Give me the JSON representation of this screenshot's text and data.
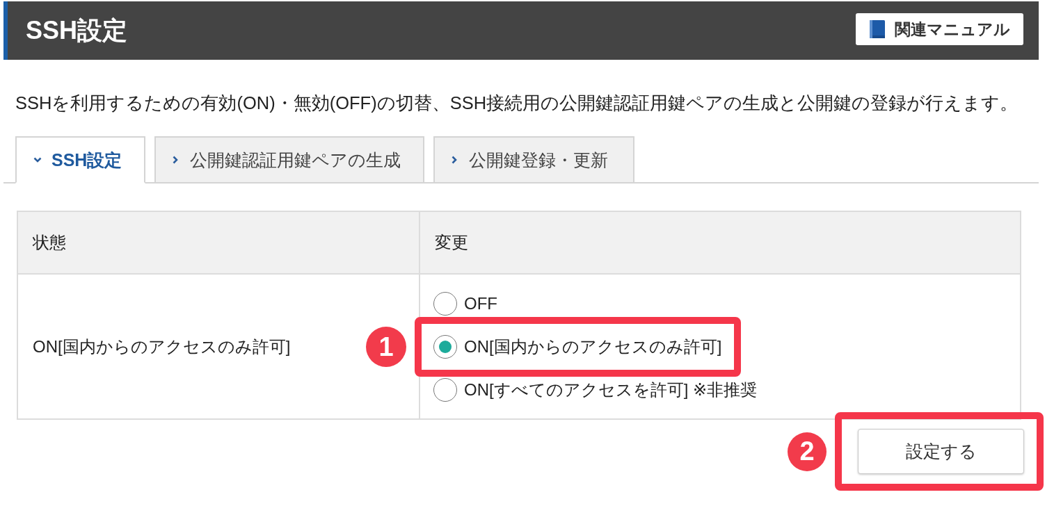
{
  "header": {
    "title": "SSH設定",
    "manual_button": "関連マニュアル"
  },
  "description": "SSHを利用するための有効(ON)・無効(OFF)の切替、SSH接続用の公開鍵認証用鍵ペアの生成と公開鍵の登録が行えます。",
  "tabs": [
    {
      "label": "SSH設定",
      "selected": true
    },
    {
      "label": "公開鍵認証用鍵ペアの生成",
      "selected": false
    },
    {
      "label": "公開鍵登録・更新",
      "selected": false
    }
  ],
  "table": {
    "columns": [
      "状態",
      "変更"
    ],
    "status": "ON[国内からのアクセスのみ許可]",
    "options": [
      {
        "label": "OFF",
        "selected": false
      },
      {
        "label": "ON[国内からのアクセスのみ許可]",
        "selected": true,
        "callout": "1"
      },
      {
        "label": "ON[すべてのアクセスを許可] ※非推奨",
        "selected": false
      }
    ]
  },
  "submit_button": {
    "label": "設定する",
    "callout": "2"
  }
}
